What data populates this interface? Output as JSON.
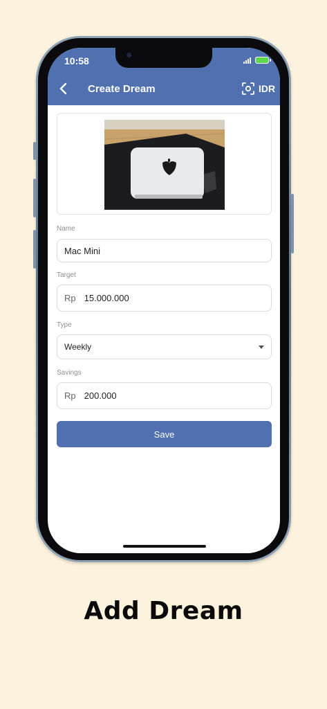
{
  "status_bar": {
    "time": "10:58"
  },
  "app_bar": {
    "back_icon": "chevron-left-icon",
    "title": "Create Dream",
    "scan_icon": "scan-icon",
    "currency": "IDR",
    "color": "#5070b0"
  },
  "image": {
    "description_icon": "mac-mini-photo"
  },
  "form": {
    "name": {
      "label": "Name",
      "value": "Mac Mini"
    },
    "target": {
      "label": "Target",
      "prefix": "Rp",
      "value": "15.000.000"
    },
    "type": {
      "label": "Type",
      "value": "Weekly"
    },
    "savings": {
      "label": "Savings",
      "prefix": "Rp",
      "value": "200.000"
    }
  },
  "save_button": {
    "label": "Save"
  },
  "caption": "Add Dream",
  "colors": {
    "background": "#fdf2dd",
    "accent": "#5070b0"
  }
}
